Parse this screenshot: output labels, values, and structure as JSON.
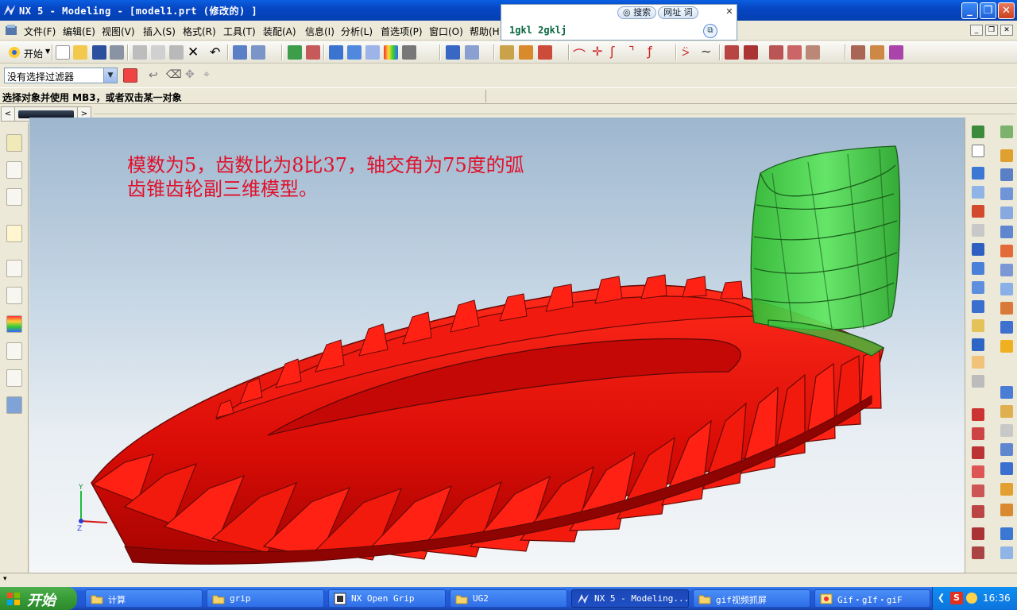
{
  "window": {
    "title": "NX 5 - Modeling - [model1.prt (修改的) ]",
    "minimize": "_",
    "maximize": "❐",
    "close": "✕"
  },
  "popup": {
    "search_label": "搜索",
    "url_label": "网址",
    "word_label": "词",
    "entry_text": "1gkl 2gklj",
    "copy_glyph": "⧉",
    "close_glyph": "✕"
  },
  "menu": {
    "items": [
      "文件(F)",
      "编辑(E)",
      "视图(V)",
      "插入(S)",
      "格式(R)",
      "工具(T)",
      "装配(A)",
      "信息(I)",
      "分析(L)",
      "首选项(P)",
      "窗口(O)",
      "帮助(H)"
    ]
  },
  "toolbar": {
    "start_label": "开始"
  },
  "filter": {
    "selected": "没有选择过滤器",
    "arrow": "▼"
  },
  "status": {
    "prompt": "选择对象并使用 MB3，或者双击某一对象"
  },
  "scroll": {
    "left": "<",
    "right": ">"
  },
  "annotation": {
    "line1": "模数为5，齿数比为8比37，轴交角为75度的弧",
    "line2": "齿锥齿轮副三维模型。"
  },
  "triad": {
    "y_label": "Y",
    "z_label": "Z"
  },
  "taskbar": {
    "start_label": "开始",
    "tasks": [
      {
        "label": "计算"
      },
      {
        "label": "grip"
      },
      {
        "label": "NX Open Grip"
      },
      {
        "label": "UG2"
      },
      {
        "label": "NX 5 - Modeling..."
      },
      {
        "label": "gif视频抓屏"
      },
      {
        "label": "Gif・gIf・giF"
      }
    ],
    "clock": "16:36"
  },
  "colors": {
    "gear_red": "#e8100a",
    "gear_green": "#3fcf3f",
    "annotation_red": "#e0102a",
    "title_blue": "#0746c4"
  }
}
